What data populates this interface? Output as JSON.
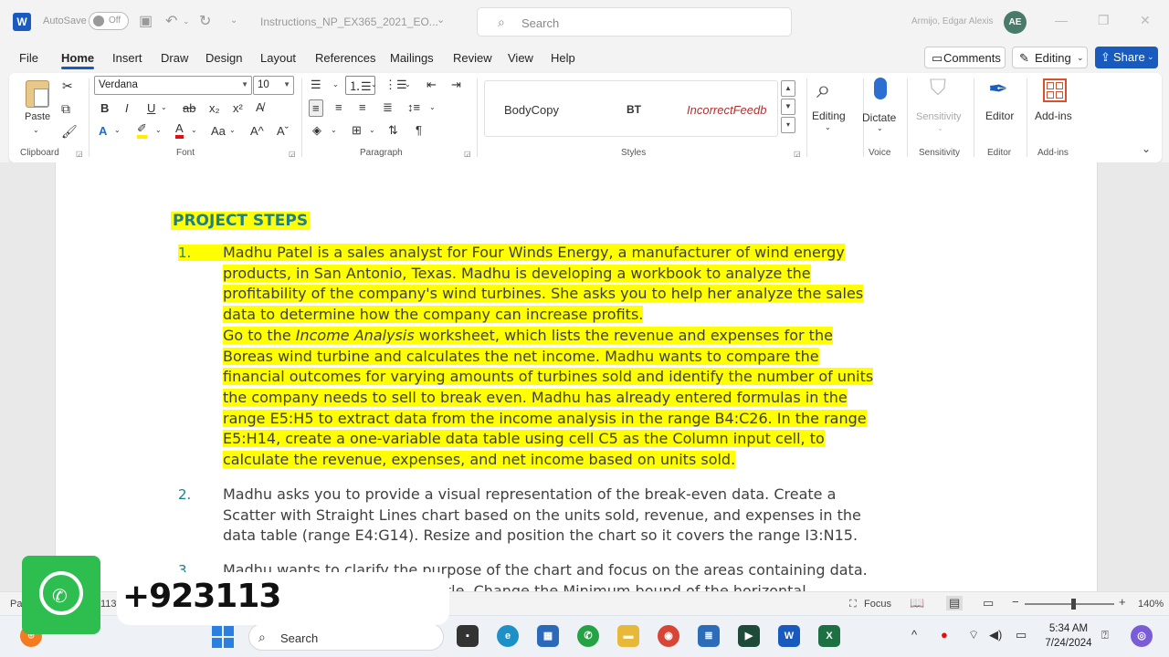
{
  "titlebar": {
    "app_icon": "W",
    "autosave_label": "AutoSave",
    "autosave_state": "Off",
    "document_title": "Instructions_NP_EX365_2021_EO...",
    "search_placeholder": "Search",
    "user_name": "Armijo, Edgar Alexis",
    "user_initials": "AE"
  },
  "menu": {
    "items": [
      "File",
      "Home",
      "Insert",
      "Draw",
      "Design",
      "Layout",
      "References",
      "Mailings",
      "Review",
      "View",
      "Help"
    ],
    "active": "Home",
    "comments_label": "Comments",
    "editing_label": "Editing",
    "share_label": "Share"
  },
  "ribbon": {
    "clipboard": {
      "paste_label": "Paste",
      "group_label": "Clipboard"
    },
    "font": {
      "font_name": "Verdana",
      "font_size": "10",
      "group_label": "Font",
      "bold": "B",
      "italic": "I",
      "underline": "U",
      "strike": "ab",
      "subscript": "x₂",
      "superscript": "x²",
      "case": "Aa",
      "grow": "A^",
      "shrink": "Aˇ"
    },
    "paragraph": {
      "group_label": "Paragraph"
    },
    "styles": {
      "group_label": "Styles",
      "items": [
        "BodyCopy",
        "BT",
        "IncorrectFeedb"
      ]
    },
    "editing": {
      "label": "Editing"
    },
    "voice": {
      "dictate_label": "Dictate",
      "group_label": "Voice"
    },
    "sensitivity": {
      "label": "Sensitivity",
      "group_label": "Sensitivity"
    },
    "editor": {
      "label": "Editor",
      "group_label": "Editor"
    },
    "addins": {
      "label": "Add-ins",
      "group_label": "Add-ins"
    }
  },
  "document": {
    "heading": "PROJECT STEPS",
    "steps": [
      {
        "number": "1.",
        "lines": [
          "Madhu Patel is a sales analyst for Four Winds Energy, a manufacturer of wind energy",
          "products, in San Antonio, Texas. Madhu is developing a workbook to analyze the",
          "profitability of the company's wind turbines. She asks you to help her analyze the sales",
          "data to determine how the company can increase profits."
        ],
        "line5_pre": "Go to the ",
        "line5_em": "Income Analysis",
        "line5_post": " worksheet, which lists the revenue and expenses for the",
        "lines2": [
          "Boreas wind turbine and calculates the net income. Madhu wants to compare the",
          "financial outcomes for varying amounts of turbines sold and identify the number of units",
          "the company needs to sell to break even. Madhu has already entered formulas in the",
          "range E5:H5 to extract data from the income analysis in the range B4:C26. In the range",
          "E5:H14, create a one-variable data table using cell C5 as the Column input cell, to",
          "calculate the revenue, expenses, and net income based on units sold."
        ]
      },
      {
        "number": "2.",
        "lines": [
          "Madhu asks you to provide a visual representation of the break-even data. Create a",
          "Scatter with Straight Lines chart based on the units sold, revenue, and expenses in the",
          "data table (range E4:G14). Resize and position the chart so it covers the range I3:N15."
        ]
      },
      {
        "number": "3.",
        "lines": [
          "Madhu wants to clarify the purpose of the chart and focus on the areas containing data.",
          "Add a chart title to the chart title. Change the Minimum bound of the horizontal"
        ]
      }
    ]
  },
  "statusbar": {
    "page_info": "Pa",
    "word_info": "113",
    "focus_label": "Focus",
    "zoom": "140%"
  },
  "taskbar": {
    "search_label": "Search",
    "time": "5:34 AM",
    "date": "7/24/2024"
  },
  "overlay": {
    "phone_text": "+923113"
  }
}
